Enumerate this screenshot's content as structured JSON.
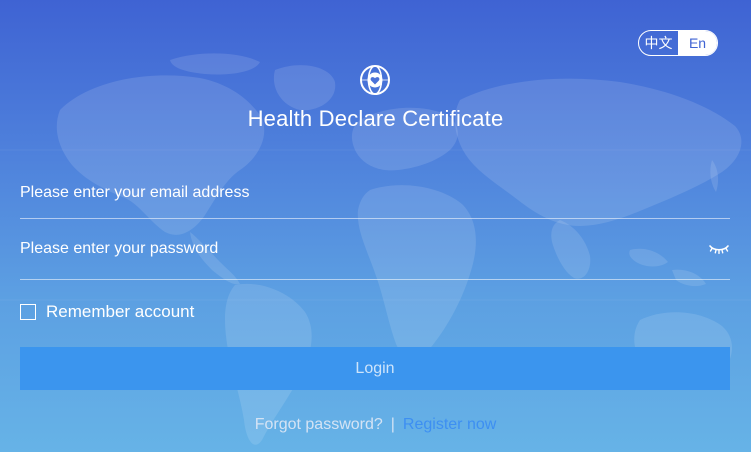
{
  "language": {
    "zh_label": "中文",
    "en_label": "En",
    "selected": "En"
  },
  "app": {
    "title": "Health Declare Certificate"
  },
  "form": {
    "email_placeholder": "Please enter your email address",
    "password_placeholder": "Please enter your password",
    "remember_label": "Remember account",
    "remember_checked": false,
    "login_label": "Login"
  },
  "footer": {
    "forgot_label": "Forgot password?",
    "separator": "|",
    "register_label": "Register now"
  },
  "colors": {
    "background_top": "#3f63d3",
    "background_bottom": "#66b3e7",
    "login_button": "#3b95ee",
    "register_link": "#3d8ff2"
  },
  "icons": {
    "logo": "globe-heart-icon",
    "password_toggle": "eye-closed-icon"
  }
}
